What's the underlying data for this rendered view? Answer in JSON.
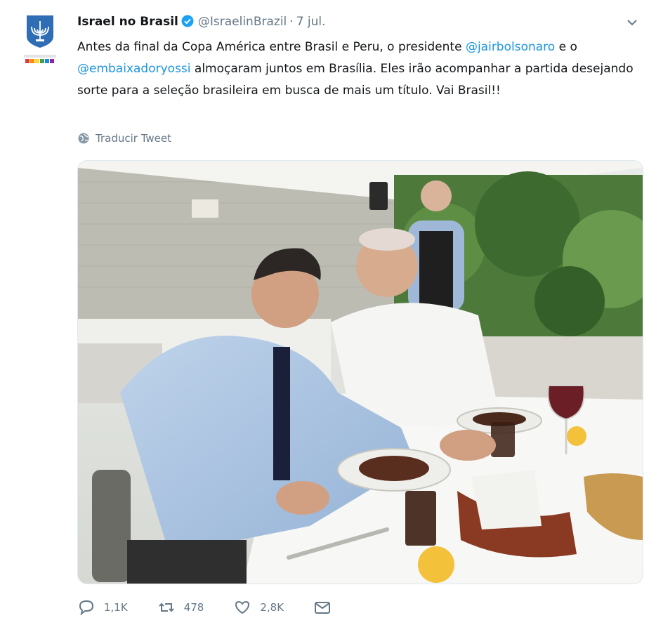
{
  "tweet": {
    "author_name": "Israel no Brasil",
    "handle": "@IsraelinBrazil",
    "separator": "·",
    "date": "7 jul.",
    "text_parts": {
      "p1": "Antes da final da Copa América entre Brasil e Peru, o presidente ",
      "mention1": "@jairbolsonaro",
      "p2": " e o ",
      "mention2": "@embaixadoryossi",
      "p3": " almoçaram juntos em Brasília. Eles irão acompanhar a partida desejando sorte para a seleção brasileira em busca de mais um título. Vai Brasil!!"
    },
    "translate_label": "Traducir Tweet"
  },
  "actions": {
    "reply_count": "1,1K",
    "retweet_count": "478",
    "like_count": "2,8K"
  },
  "colors": {
    "link": "#1b95e0",
    "muted": "#657786",
    "verified": "#1da1f2"
  }
}
